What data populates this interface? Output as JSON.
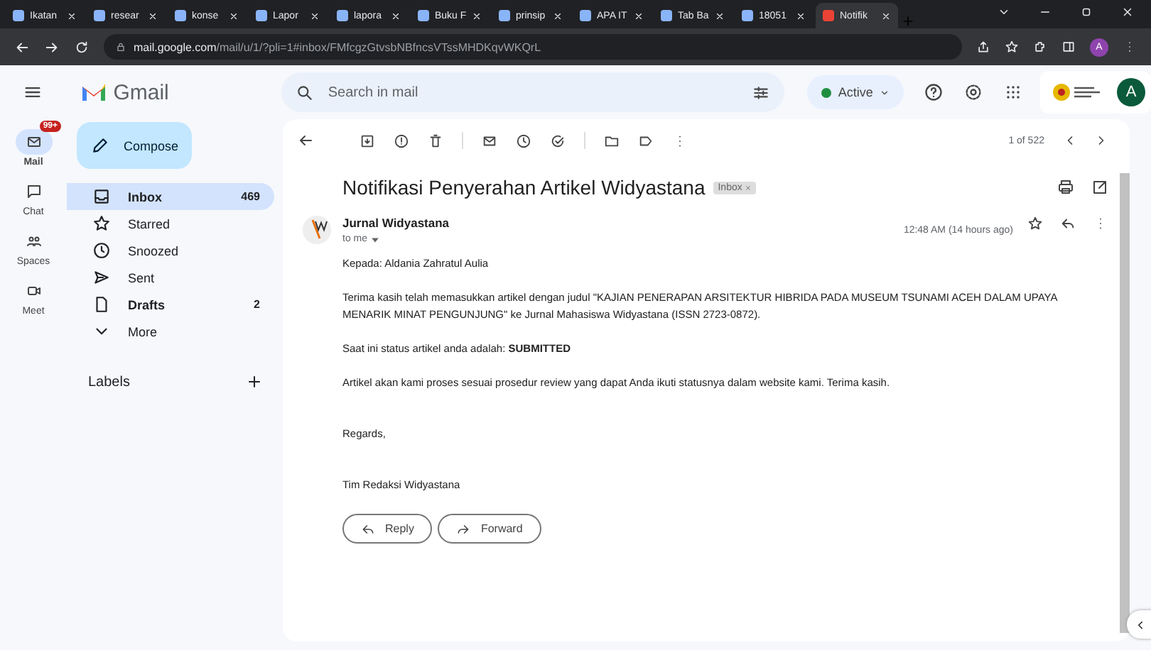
{
  "browser": {
    "tabs": [
      {
        "title": "Ikatan",
        "selected": false
      },
      {
        "title": "resear",
        "selected": false
      },
      {
        "title": "konse",
        "selected": false
      },
      {
        "title": "Lapor",
        "selected": false
      },
      {
        "title": "lapora",
        "selected": false
      },
      {
        "title": "Buku F",
        "selected": false
      },
      {
        "title": "prinsip",
        "selected": false
      },
      {
        "title": "APA IT",
        "selected": false
      },
      {
        "title": "Tab Ba",
        "selected": false
      },
      {
        "title": "18051",
        "selected": false
      },
      {
        "title": "Notifik",
        "selected": true
      }
    ],
    "url": {
      "host": "mail.google.com",
      "path": "/mail/u/1/?pli=1#inbox/FMfcgzGtvsbNBfncsVTssMHDKqvWKQrL"
    },
    "profile": "A"
  },
  "app": {
    "name": "Gmail"
  },
  "search": {
    "placeholder": "Search in mail"
  },
  "status": {
    "label": "Active"
  },
  "account": {
    "avatar": "A"
  },
  "rail": [
    {
      "label": "Mail",
      "selected": true,
      "badge": "99+"
    },
    {
      "label": "Chat",
      "selected": false
    },
    {
      "label": "Spaces",
      "selected": false
    },
    {
      "label": "Meet",
      "selected": false
    }
  ],
  "compose": {
    "label": "Compose"
  },
  "folders": [
    {
      "kind": "inbox",
      "label": "Inbox",
      "count": "469",
      "selected": true,
      "unread": true
    },
    {
      "kind": "starred",
      "label": "Starred",
      "selected": false,
      "unread": false
    },
    {
      "kind": "snoozed",
      "label": "Snoozed",
      "selected": false,
      "unread": false
    },
    {
      "kind": "sent",
      "label": "Sent",
      "selected": false,
      "unread": false
    },
    {
      "kind": "drafts",
      "label": "Drafts",
      "count": "2",
      "selected": false,
      "unread": true
    },
    {
      "kind": "more",
      "label": "More",
      "selected": false,
      "unread": false
    }
  ],
  "labels": {
    "title": "Labels"
  },
  "pager": {
    "position": "1 of 522"
  },
  "message": {
    "subject": "Notifikasi Penyerahan Artikel Widyastana",
    "chip": "Inbox",
    "sender": "Jurnal Widyastana",
    "recipient": "to me",
    "time": "12:48 AM (14 hours ago)",
    "body": [
      "Kepada: Aldania Zahratul Aulia",
      "Terima kasih telah memasukkan artikel dengan judul  \"KAJIAN PENERAPAN ARSITEKTUR HIBRIDA PADA MUSEUM TSUNAMI ACEH DALAM UPAYA MENARIK MINAT PENGUNJUNG\"  ke Jurnal Mahasiswa Widyastana (ISSN 2723-0872).",
      "Saat ini status artikel anda adalah: **SUBMITTED**",
      "Artikel akan kami proses sesuai prosedur review yang dapat Anda ikuti statusnya dalam website kami. Terima kasih.",
      "Regards,",
      "Tim Redaksi Widyastana"
    ],
    "actions": [
      {
        "kind": "reply",
        "label": "Reply"
      },
      {
        "kind": "forward",
        "label": "Forward"
      }
    ]
  }
}
